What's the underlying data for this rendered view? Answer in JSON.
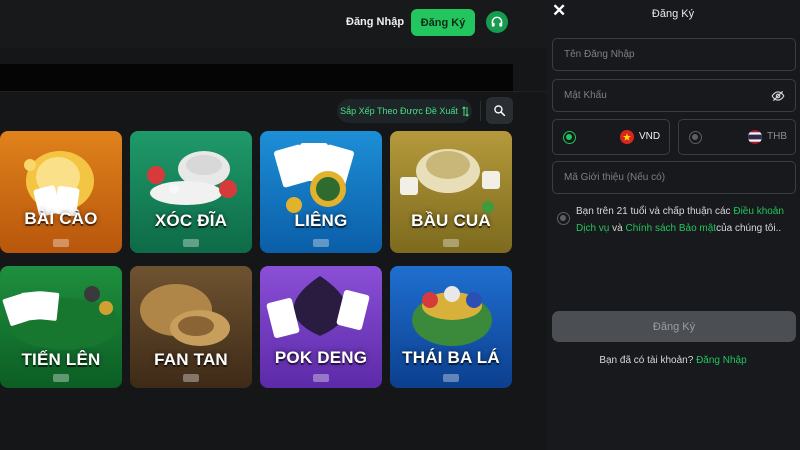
{
  "header": {
    "login_label": "Đăng Nhập",
    "register_label": "Đăng Ký",
    "support_icon": "headset-icon"
  },
  "toolbar": {
    "sort_label": "Sắp Xếp Theo Được Đề Xuất",
    "sort_icon": "sort-arrows-icon",
    "search_icon": "search-icon"
  },
  "games": [
    {
      "name": "BÀI CÀO"
    },
    {
      "name": "XÓC ĐĨA"
    },
    {
      "name": "LIÊNG"
    },
    {
      "name": "BẦU CUA"
    },
    {
      "name": "TIẾN LÊN"
    },
    {
      "name": "FAN TAN"
    },
    {
      "name": "POK DENG"
    },
    {
      "name": "THÁI BA LÁ"
    }
  ],
  "register_panel": {
    "title": "Đăng Ký",
    "username_placeholder": "Tên Đăng Nhập",
    "password_placeholder": "Mật Khẩu",
    "currencies": [
      {
        "code": "VND",
        "selected": true
      },
      {
        "code": "THB",
        "selected": false
      }
    ],
    "referral_placeholder": "Mã Giới thiệu (Nếu có)",
    "terms": {
      "prefix": "Bạn trên 21 tuổi và chấp thuận các ",
      "terms_link": "Điều khoản Dịch vụ",
      "mid": " và ",
      "privacy_link": "Chính sách Bảo mật",
      "suffix": "của chúng tôi.."
    },
    "submit_label": "Đăng Ký",
    "have_account_text": "Bạn đã có tài khoản?",
    "login_link": "Đăng Nhập"
  },
  "colors": {
    "accent": "#22c55e",
    "background": "#141618",
    "panel": "#17191c",
    "submit_disabled": "#4b4f54"
  }
}
